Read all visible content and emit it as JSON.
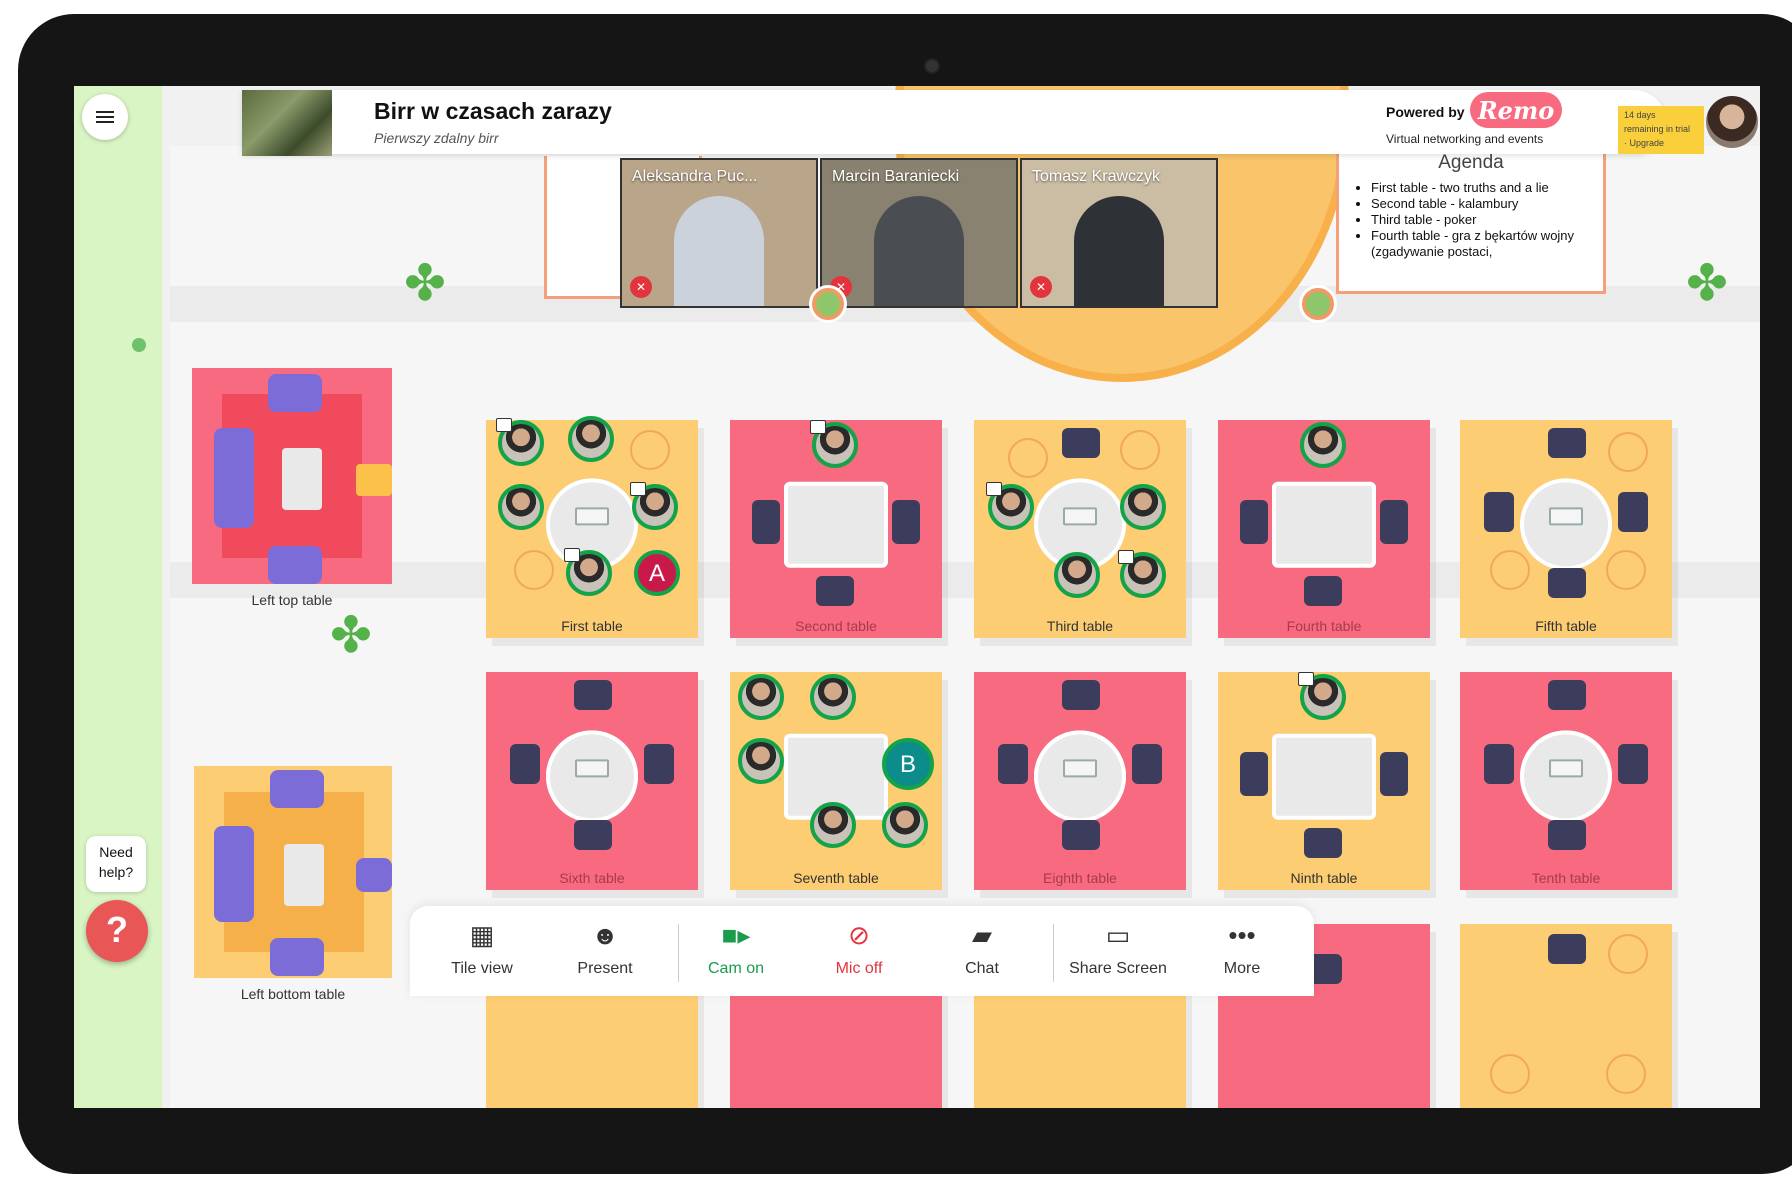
{
  "header": {
    "title": "Birr w czasach zarazy",
    "subtitle": "Pierwszy zdalny birr",
    "powered_by": "Powered by",
    "brand": "Remo",
    "tagline": "Virtual networking and events",
    "trial_line1": "14 days",
    "trial_line2": "remaining in trial",
    "trial_line3": "· Upgrade"
  },
  "stage": {
    "speakers": [
      {
        "name": "Aleksandra Puc...",
        "muted": true
      },
      {
        "name": "Marcin Baraniecki",
        "muted": true
      },
      {
        "name": "Tomasz Krawczyk",
        "muted": true
      }
    ],
    "agenda": {
      "title": "Agenda",
      "items": [
        "First table - two truths and a lie",
        "Second table - kalambury",
        "Third table - poker",
        "Fourth table - gra z bękartów wojny (zgadywanie postaci,"
      ]
    }
  },
  "rooms": {
    "left_top": "Left top table",
    "left_bottom": "Left bottom table",
    "tables": [
      "First table",
      "Second table",
      "Third table",
      "Fourth table",
      "Fifth table",
      "Sixth table",
      "Seventh table",
      "Eighth table",
      "Ninth table",
      "Tenth table"
    ],
    "badges": {
      "first_letter": "A",
      "seventh_letter": "B"
    }
  },
  "toolbar": {
    "tile_view": "Tile view",
    "present": "Present",
    "cam_on": "Cam on",
    "mic_off": "Mic off",
    "chat": "Chat",
    "share_screen": "Share Screen",
    "more": "More"
  },
  "help": {
    "bubble": "Need help?",
    "icon": "?"
  },
  "colors": {
    "remo_pink": "#f76a80",
    "table_yellow": "#fccd73",
    "table_pink": "#f76a80",
    "cam_green": "#1a9c4a",
    "mic_red": "#e3343d"
  }
}
